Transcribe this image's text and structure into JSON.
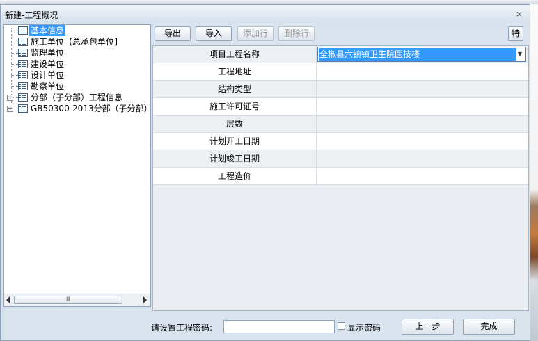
{
  "window": {
    "title": "新建-工程概况",
    "close_glyph": "⨯"
  },
  "tree": {
    "items": [
      {
        "label": "基本信息",
        "selected": true
      },
      {
        "label": "施工单位【总承包单位】"
      },
      {
        "label": "监理单位"
      },
      {
        "label": "建设单位"
      },
      {
        "label": "设计单位"
      },
      {
        "label": "勘察单位"
      },
      {
        "label": "分部（子分部）工程信息",
        "expandable": true
      },
      {
        "label": "GB50300-2013分部（子分部）工程",
        "expandable": true
      }
    ],
    "expand_glyph": "+",
    "scroll_grip": "Ⅲ"
  },
  "toolbar": {
    "export_label": "导出",
    "import_label": "导入",
    "add_row_label": "添加行",
    "delete_row_label": "删除行",
    "special_label": "特"
  },
  "grid": {
    "rows": [
      {
        "key": "项目工程名称",
        "value": "全椒县六镇镇卫生院医技楼"
      },
      {
        "key": "工程地址",
        "value": ""
      },
      {
        "key": "结构类型",
        "value": ""
      },
      {
        "key": "施工许可证号",
        "value": ""
      },
      {
        "key": "层数",
        "value": ""
      },
      {
        "key": "计划开工日期",
        "value": ""
      },
      {
        "key": "计划竣工日期",
        "value": ""
      },
      {
        "key": "工程造价",
        "value": ""
      }
    ]
  },
  "footer": {
    "password_label": "请设置工程密码:",
    "password_value": "",
    "show_password_label": "显示密码",
    "prev_label": "上一步",
    "finish_label": "完成"
  },
  "colors": {
    "selection": "#3399ff",
    "dialog_bg": "#d9e3ee",
    "border": "#8ea3bb"
  }
}
